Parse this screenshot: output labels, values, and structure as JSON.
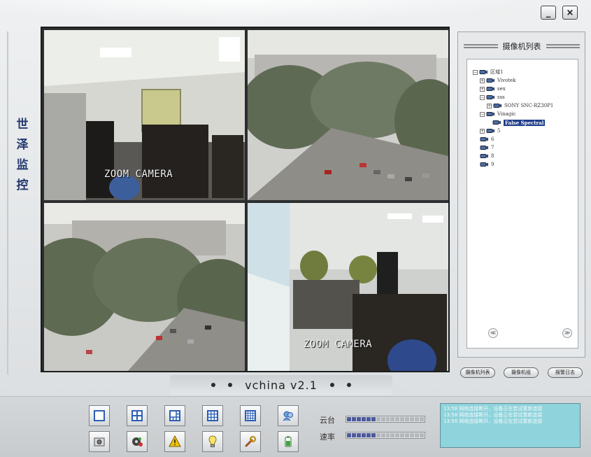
{
  "window": {
    "minimize_label": "_",
    "close_label": "×"
  },
  "brand": {
    "chars": [
      "世",
      "泽",
      "监",
      "控"
    ]
  },
  "cameras": [
    {
      "overlay": "ZOOM CAMERA"
    },
    {
      "overlay": ""
    },
    {
      "overlay": ""
    },
    {
      "overlay": "ZOOM CAMERA"
    }
  ],
  "tree": {
    "title": "摄像机列表",
    "items": [
      {
        "toggle": "⊟",
        "label": "区域1"
      },
      {
        "toggle": "⊞",
        "label": "Vivotek"
      },
      {
        "toggle": "⊞",
        "label": "sex"
      },
      {
        "toggle": "⊟",
        "label": "sss"
      },
      {
        "toggle": "⊞",
        "label": "SONY SNC-RZ30P1"
      },
      {
        "toggle": "⊟",
        "label": "Vinagic"
      },
      {
        "toggle": "",
        "label": "False Spectral"
      },
      {
        "toggle": "⊞",
        "label": "5"
      },
      {
        "toggle": "",
        "label": "6"
      },
      {
        "toggle": "",
        "label": "7"
      },
      {
        "toggle": "",
        "label": "8"
      },
      {
        "toggle": "",
        "label": "9"
      }
    ],
    "scroll_left": "≪",
    "scroll_right": "≫"
  },
  "side_buttons": [
    "摄像机列表",
    "摄像机组",
    "报警日志"
  ],
  "version": {
    "label": "vchina v2.1"
  },
  "ptz": {
    "label1": "云台",
    "label2": "速率",
    "level1": 0.4,
    "level2": 0.4
  },
  "log": {
    "lines": [
      "13:58 网络连接断开，设备正在尝试重新连接",
      "13:58 网络连接断开，设备正在尝试重新连接",
      "13:58 网络连接断开，设备正在尝试重新连接"
    ]
  }
}
